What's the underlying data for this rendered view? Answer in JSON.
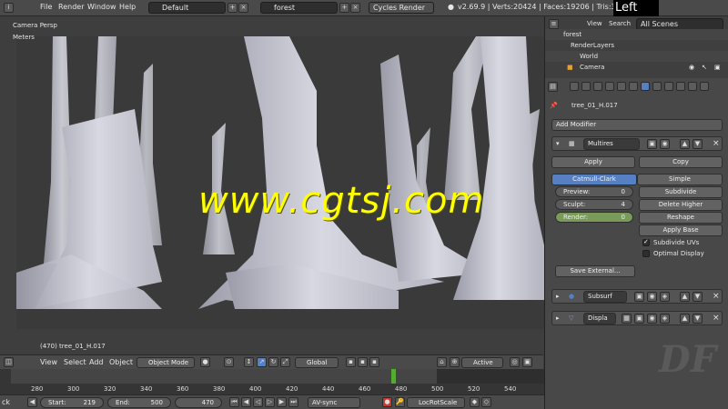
{
  "topbar": {
    "menu": [
      "File",
      "Render",
      "Window",
      "Help"
    ],
    "screen_layout": "Default",
    "scene": "forest",
    "engine": "Cycles Render",
    "stats": "v2.69.9 | Verts:20424 | Faces:19206 | Tris:38412 | O",
    "overlay_title": "Left"
  },
  "viewport": {
    "view_label": "Camera Persp",
    "units_label": "Meters",
    "object_label": "(470) tree_01_H.017",
    "watermark": "www.cgtsj.com"
  },
  "vp_header": {
    "menu": [
      "View",
      "Select",
      "Add",
      "Object"
    ],
    "mode": "Object Mode",
    "orientation": "Global",
    "pivot": "Active"
  },
  "timeline": {
    "ticks": [
      "280",
      "300",
      "320",
      "340",
      "360",
      "380",
      "400",
      "420",
      "440",
      "460",
      "480",
      "500",
      "520",
      "540"
    ],
    "current_frame_fraction": 0.7
  },
  "botbar": {
    "left_label": "ck",
    "start_label": "Start:",
    "start_value": "219",
    "end_label": "End:",
    "end_value": "500",
    "current_value": "470",
    "sync": "AV-sync",
    "keying": "LocRotScale"
  },
  "outliner": {
    "view": "View",
    "search": "Search",
    "scenes": "All Scenes",
    "rows": [
      "forest",
      "RenderLayers",
      "World",
      "Camera"
    ]
  },
  "props": {
    "object_name": "tree_01_H.017",
    "add_modifier": "Add Modifier",
    "modifier_name": "Multires",
    "apply": "Apply",
    "copy": "Copy",
    "catmull": "Catmull-Clark",
    "simple": "Simple",
    "preview_label": "Preview:",
    "preview_value": "0",
    "sculpt_label": "Sculpt:",
    "sculpt_value": "4",
    "render_label": "Render:",
    "render_value": "0",
    "subdivide": "Subdivide",
    "delete_higher": "Delete Higher",
    "reshape": "Reshape",
    "apply_base": "Apply Base",
    "subdivide_uvs": "Subdivide UVs",
    "optimal_display": "Optimal Display",
    "save_external": "Save External...",
    "mod2": "Subsurf",
    "mod3": "Displa"
  },
  "colors": {
    "accent_blue": "#5680c2",
    "render_green": "#7a9a5a",
    "watermark": "#ffff00"
  },
  "logo": "DF"
}
